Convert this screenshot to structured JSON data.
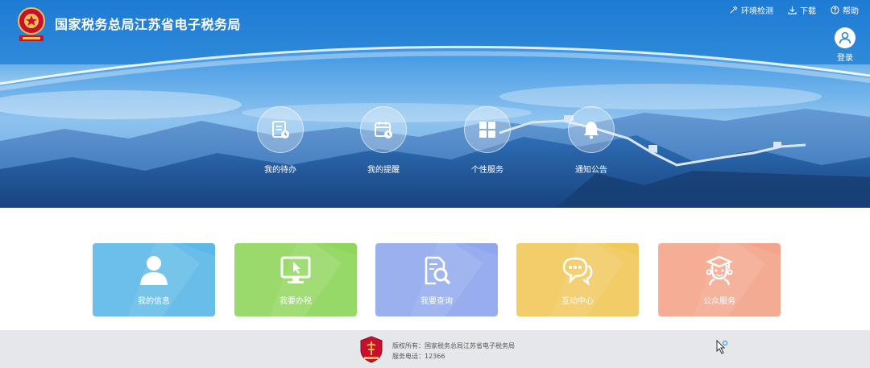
{
  "header": {
    "title": "国家税务总局江苏省电子税务局",
    "emblem_icon": "tax-emblem-icon",
    "toolbar": [
      {
        "label": "环境检测",
        "icon": "test-icon"
      },
      {
        "label": "下载",
        "icon": "download-icon"
      },
      {
        "label": "帮助",
        "icon": "help-icon"
      }
    ],
    "login_label": "登录"
  },
  "quick_links": [
    {
      "label": "我的待办",
      "icon": "todo-doc-icon"
    },
    {
      "label": "我的提醒",
      "icon": "calendar-reminder-icon"
    },
    {
      "label": "个性服务",
      "icon": "grid-apps-icon"
    },
    {
      "label": "通知公告",
      "icon": "bell-icon"
    }
  ],
  "cards": [
    {
      "label": "我的信息",
      "icon": "user-icon",
      "color": "#5cb8e8"
    },
    {
      "label": "我要办税",
      "icon": "monitor-icon",
      "color": "#8fd65c"
    },
    {
      "label": "我要查询",
      "icon": "search-doc-icon",
      "color": "#8fa7ee"
    },
    {
      "label": "互动中心",
      "icon": "chat-icon",
      "color": "#f1c85a"
    },
    {
      "label": "公众服务",
      "icon": "service-person-icon",
      "color": "#f4a48b"
    }
  ],
  "footer": {
    "copyright": "版权所有：国家税务总局江苏省电子税务局",
    "phone": "服务电话：12366"
  },
  "colors": {
    "header_blue": "#1e7bd3",
    "footer_bg": "#e6e7ea"
  }
}
